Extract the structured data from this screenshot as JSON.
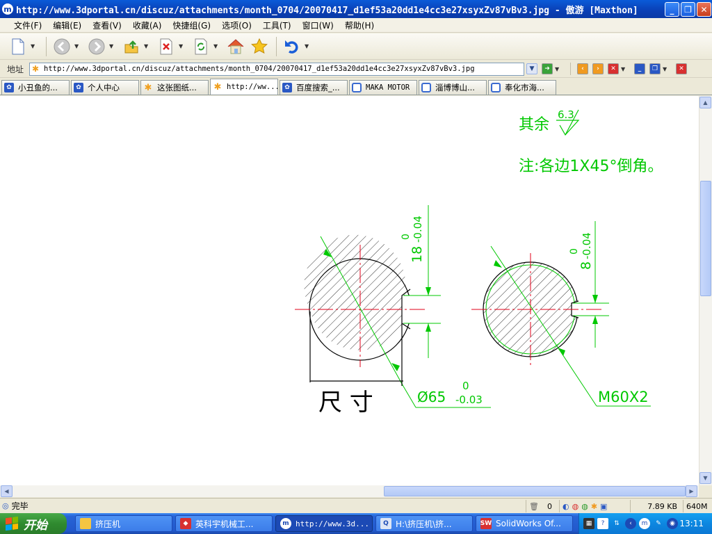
{
  "window": {
    "title": "http://www.3dportal.cn/discuz/attachments/month_0704/20070417_d1ef53a20dd1e4cc3e27xsyxZv87vBv3.jpg - 傲游 [Maxthon]",
    "app_icon_glyph": "m",
    "minimize_glyph": "_",
    "restore_glyph": "❐",
    "close_glyph": "✕"
  },
  "menu": [
    {
      "label": "文件(F)"
    },
    {
      "label": "编辑(E)"
    },
    {
      "label": "查看(V)"
    },
    {
      "label": "收藏(A)"
    },
    {
      "label": "快捷组(G)"
    },
    {
      "label": "选项(O)"
    },
    {
      "label": "工具(T)"
    },
    {
      "label": "窗口(W)"
    },
    {
      "label": "帮助(H)"
    }
  ],
  "address": {
    "label": "地址",
    "url": "http://www.3dportal.cn/discuz/attachments/month_0704/20070417_d1ef53a20dd1e4cc3e27xsyxZv87vBv3.jpg"
  },
  "tabs": [
    {
      "label": "小丑鱼的..."
    },
    {
      "label": "个人中心"
    },
    {
      "label": "这张图纸..."
    },
    {
      "label": "http://ww..."
    },
    {
      "label": "百度搜索_..."
    },
    {
      "label": "MAKA MOTOR"
    },
    {
      "label": "淄博博山..."
    },
    {
      "label": "奉化市海..."
    }
  ],
  "drawing": {
    "note_rest": "其余",
    "roughness": "6.3",
    "note_chamfer": "注:各边1X45°倒角。",
    "dim_left_key": "18",
    "dim_left_key_upper": "0",
    "dim_left_key_lower": "-0.04",
    "dim_right_key": "8",
    "dim_right_key_upper": "0",
    "dim_right_key_lower": "-0.04",
    "dia_main": "Ø65",
    "dia_upper": "0",
    "dia_lower": "-0.03",
    "thread": "M60X2",
    "handwritten": "尺 寸",
    "colors": {
      "line": "#00c800",
      "center": "#e0001a",
      "hatch": "#000000"
    }
  },
  "status": {
    "text": "完毕",
    "count": "0",
    "size": "7.89 KB",
    "memory": "640M"
  },
  "taskbar": {
    "start": "开始",
    "tasks": [
      {
        "label": "挤压机"
      },
      {
        "label": "英科宇机械工..."
      },
      {
        "label": "http://www.3d..."
      },
      {
        "label": "H:\\挤压机\\挤..."
      },
      {
        "label": "SolidWorks Of..."
      }
    ],
    "clock": "13:11"
  }
}
